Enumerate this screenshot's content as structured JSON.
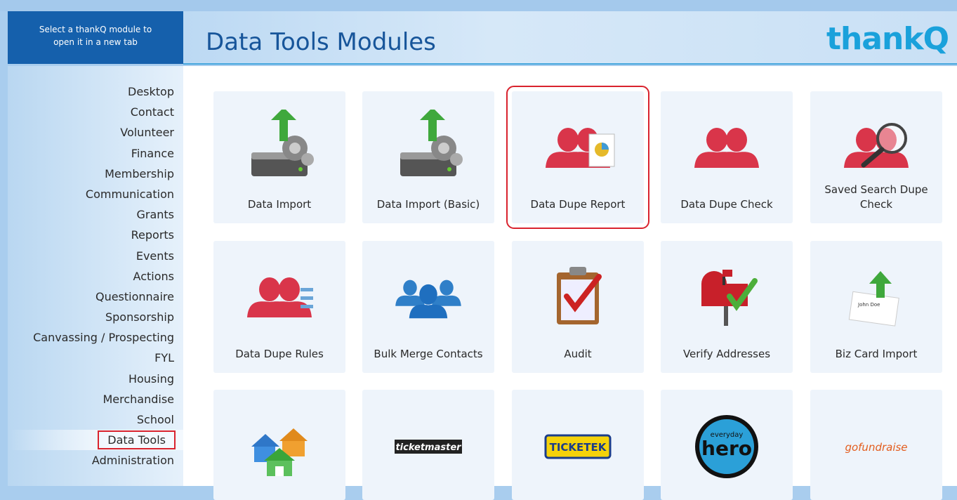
{
  "header": {
    "hint": "Select a thankQ module to open it in a new tab",
    "title": "Data Tools Modules",
    "logo": "thankQ"
  },
  "sidebar": {
    "items": [
      {
        "label": "Desktop"
      },
      {
        "label": "Contact"
      },
      {
        "label": "Volunteer"
      },
      {
        "label": "Finance"
      },
      {
        "label": "Membership"
      },
      {
        "label": "Communication"
      },
      {
        "label": "Grants"
      },
      {
        "label": "Reports"
      },
      {
        "label": "Events"
      },
      {
        "label": "Actions"
      },
      {
        "label": "Questionnaire"
      },
      {
        "label": "Sponsorship"
      },
      {
        "label": "Canvassing / Prospecting"
      },
      {
        "label": "FYL"
      },
      {
        "label": "Housing"
      },
      {
        "label": "Merchandise"
      },
      {
        "label": "School"
      },
      {
        "label": "Data Tools",
        "active": true
      },
      {
        "label": "Administration"
      }
    ]
  },
  "tiles": [
    {
      "label": "Data Import",
      "icon": "server-upload-icon"
    },
    {
      "label": "Data Import (Basic)",
      "icon": "server-upload-icon"
    },
    {
      "label": "Data Dupe Report",
      "icon": "people-report-icon",
      "selected": true
    },
    {
      "label": "Data Dupe Check",
      "icon": "people-icon"
    },
    {
      "label": "Saved Search Dupe Check",
      "icon": "people-search-icon"
    },
    {
      "label": "Data Dupe Rules",
      "icon": "people-rules-icon"
    },
    {
      "label": "Bulk Merge Contacts",
      "icon": "people-group-icon"
    },
    {
      "label": "Audit",
      "icon": "clipboard-check-icon"
    },
    {
      "label": "Verify Addresses",
      "icon": "mailbox-check-icon"
    },
    {
      "label": "Biz Card Import",
      "icon": "business-card-icon"
    },
    {
      "label": "",
      "icon": "houses-icon"
    },
    {
      "label": "",
      "icon": "ticketmaster-logo",
      "logo_text": "ticketmaster"
    },
    {
      "label": "",
      "icon": "ticketek-logo",
      "logo_text": "TICKETEK"
    },
    {
      "label": "",
      "icon": "everyday-hero-logo",
      "logo_text_top": "everyday",
      "logo_text": "hero"
    },
    {
      "label": "",
      "icon": "gofundraise-logo",
      "logo_text": "gofundraise"
    }
  ],
  "colors": {
    "accent": "#1560ac",
    "title": "#17559a",
    "logo": "#1aa1db",
    "highlight": "#d9232e",
    "people": "#d9354a",
    "tile_bg": "#eef4fb"
  }
}
